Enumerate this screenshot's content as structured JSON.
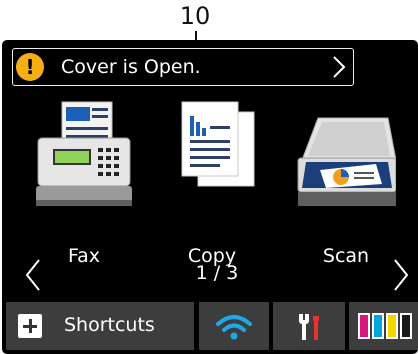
{
  "callout": {
    "number": "10"
  },
  "message": {
    "text": "Cover is Open.",
    "icon": "alert-icon",
    "arrow_icon": "chevron-right-icon",
    "alert_color": "#f5ae14"
  },
  "apps": [
    {
      "label": "Fax",
      "icon": "fax-icon"
    },
    {
      "label": "Copy",
      "icon": "copy-icon"
    },
    {
      "label": "Scan",
      "icon": "scan-icon"
    }
  ],
  "pager": {
    "indicator": "1 / 3",
    "prev_icon": "chevron-left-icon",
    "next_icon": "chevron-right-icon"
  },
  "bottom_bar": {
    "shortcuts_label": "Shortcuts",
    "shortcuts_icon": "plus-icon",
    "wifi_icon": "wifi-icon",
    "settings_icon": "tools-icon",
    "ink_icon": "ink-cartridges-icon",
    "wifi_color": "#1ea8e8",
    "ink_colors": [
      "#1a1a1a",
      "#d8177c",
      "#00a6e0",
      "#f3d600"
    ]
  }
}
